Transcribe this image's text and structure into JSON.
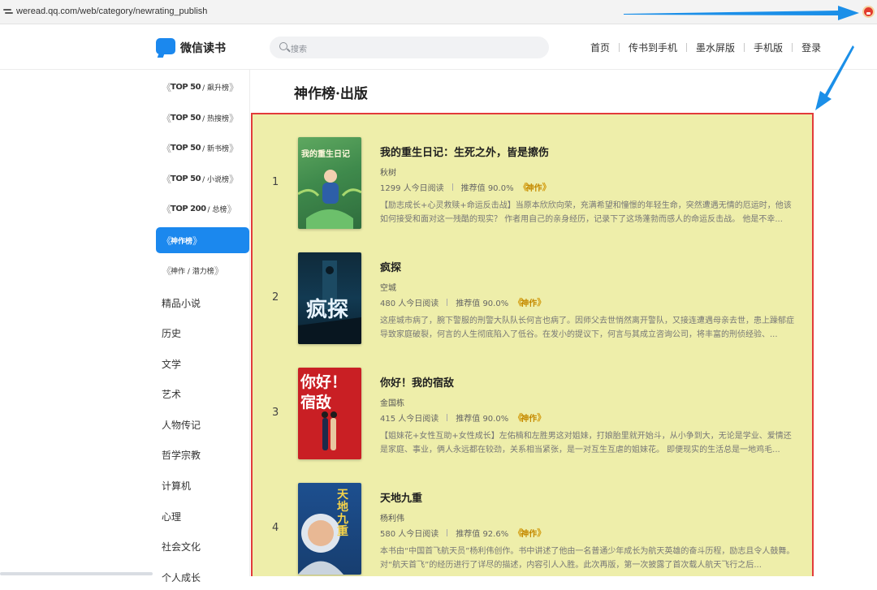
{
  "browser": {
    "url": "weread.qq.com/web/category/newrating_publish"
  },
  "header": {
    "logo_text": "微信读书",
    "search_placeholder": "搜索",
    "nav": [
      "首页",
      "传书到手机",
      "墨水屏版",
      "手机版",
      "登录"
    ]
  },
  "sidebar": {
    "badges": [
      {
        "big": "TOP 50",
        "sub": "/ 飙升榜"
      },
      {
        "big": "TOP 50",
        "sub": "/ 热搜榜"
      },
      {
        "big": "TOP 50",
        "sub": "/ 新书榜"
      },
      {
        "big": "TOP 50",
        "sub": "/ 小说榜"
      },
      {
        "big": "TOP 200",
        "sub": "/ 总榜"
      },
      {
        "big": "",
        "sub": "神作榜"
      },
      {
        "big": "",
        "sub": "神作 / 潜力榜"
      }
    ],
    "categories": [
      "精品小说",
      "历史",
      "文学",
      "艺术",
      "人物传记",
      "哲学宗教",
      "计算机",
      "心理",
      "社会文化",
      "个人成长"
    ]
  },
  "main": {
    "title": "神作榜·出版",
    "books": [
      {
        "rank": "1",
        "title": "我的重生日记：生死之外，皆是擦伤",
        "author": "秋树",
        "readers": "1299 人今日阅读",
        "recommend": "推荐值 90.0%",
        "tag": "神作",
        "desc": "【励志成长+心灵救赎+命运反击战】当原本欣欣向荣，充满希望和憧憬的年轻生命，突然遭遇无情的厄运时，他该如何接受和面对这一残酷的现实？ 作者用自己的亲身经历，记录下了这场蓬勃而感人的命运反击战。 他是不幸...",
        "cover_text": "我的重生日记"
      },
      {
        "rank": "2",
        "title": "疯探",
        "author": "空城",
        "readers": "480 人今日阅读",
        "recommend": "推荐值 90.0%",
        "tag": "神作",
        "desc": "这座城市病了，腕下警服的刑警大队队长何言也病了。因师父去世悄然离开警队，又接连遭遇母亲去世，患上躁郁症导致家庭破裂，何言的人生彻底陷入了低谷。在发小的提议下，何言与其成立咨询公司，将丰富的刑侦经验、...",
        "cover_text": "疯探"
      },
      {
        "rank": "3",
        "title": "你好！我的宿敌",
        "author": "金国栋",
        "readers": "415 人今日阅读",
        "recommend": "推荐值 90.0%",
        "tag": "神作",
        "desc": "【姐妹花+女性互助+女性成长】左佑楠和左胜男这对姐妹，打娘胎里就开始斗，从小争到大，无论是学业、爱情还是家庭、事业，俩人永远都在较劲，关系相当紧张，是一对互生互虐的姐妹花。 即便现实的生活总是一地鸡毛...",
        "cover_text": "你好！宿敌"
      },
      {
        "rank": "4",
        "title": "天地九重",
        "author": "杨利伟",
        "readers": "580 人今日阅读",
        "recommend": "推荐值 92.6%",
        "tag": "神作",
        "desc": "本书由“中国首飞航天员”杨利伟创作。书中讲述了他由一名普通少年成长为航天英雄的奋斗历程，励志且令人鼓舞。对“航天首飞”的经历进行了详尽的描述，内容引人入胜。此次再版，第一次披露了首次载人航天飞行之后...",
        "cover_text": "天地九重"
      }
    ]
  },
  "colors": {
    "accent": "#1b88ee",
    "panel_bg": "#eeeeaa",
    "highlight_border": "#e23b3b",
    "annotation_arrow": "#1b8fe8"
  }
}
